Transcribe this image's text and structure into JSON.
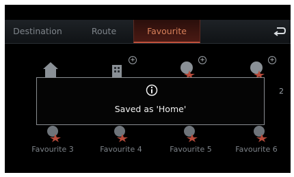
{
  "tabs": {
    "destination": "Destination",
    "route": "Route",
    "favourite": "Favourite"
  },
  "favourites": {
    "row2_labels": [
      "Favourite 3",
      "Favourite 4",
      "Favourite 5",
      "Favourite 6"
    ],
    "partial_label": "2"
  },
  "dialog": {
    "message": "Saved as 'Home'",
    "icon": "info-icon"
  },
  "colors": {
    "active_tab": "#d9805a",
    "background": "#000000",
    "text_muted": "#7e848a"
  }
}
